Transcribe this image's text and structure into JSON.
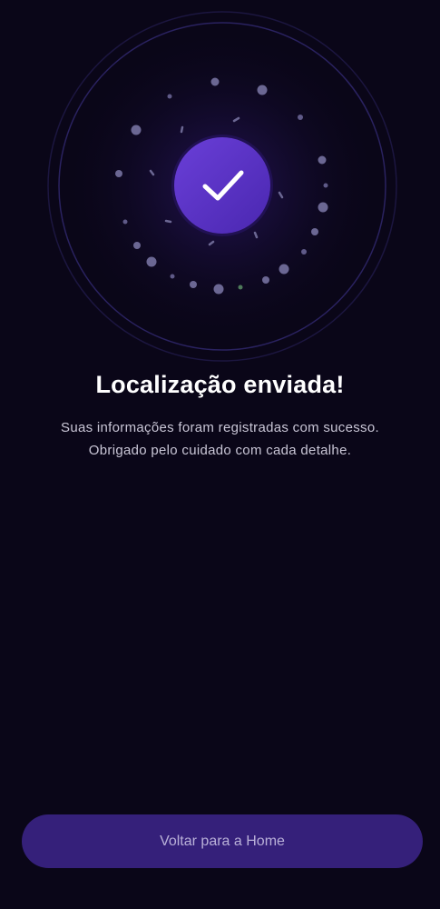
{
  "success": {
    "title": "Localização enviada!",
    "message_line1": "Suas informações foram registradas com sucesso.",
    "message_line2": "Obrigado pelo cuidado com cada detalhe."
  },
  "actions": {
    "home_button_label": "Voltar para a Home"
  },
  "icons": {
    "success": "check-icon"
  },
  "colors": {
    "background": "#0a0618",
    "accent": "#5b35c9",
    "button": "#35207a"
  }
}
